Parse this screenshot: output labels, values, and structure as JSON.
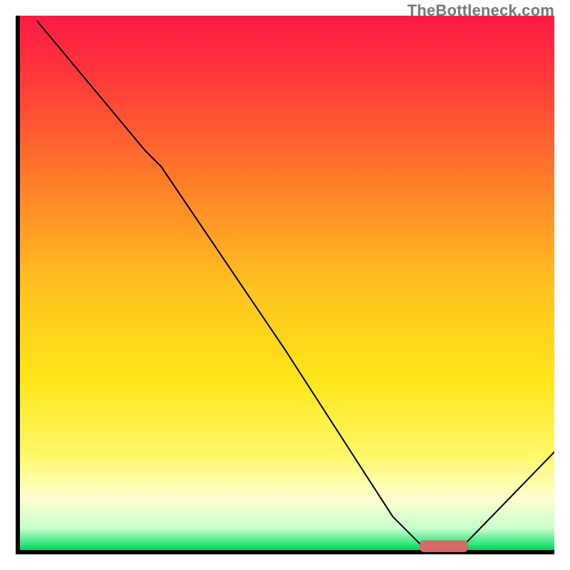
{
  "watermark": "TheBottleneck.com",
  "chart_data": {
    "type": "line",
    "title": "",
    "xlabel": "",
    "ylabel": "",
    "xlim": [
      0,
      100
    ],
    "ylim": [
      0,
      100
    ],
    "series": [
      {
        "name": "curve",
        "color": "#000000",
        "width": 2,
        "x": [
          4,
          14,
          24,
          27,
          50,
          70,
          75,
          82,
          83,
          100
        ],
        "y": [
          99,
          87,
          75,
          72,
          38,
          7,
          2,
          1.5,
          1.5,
          19
        ]
      }
    ],
    "marker": {
      "name": "highlight-bar",
      "color": "#d46a6a",
      "x_start": 75,
      "x_end": 84,
      "y": 1.5,
      "thickness": 2.2
    },
    "background_gradient": {
      "stops": [
        {
          "offset": 0.0,
          "color": "#ff1a44"
        },
        {
          "offset": 0.12,
          "color": "#ff3a3a"
        },
        {
          "offset": 0.3,
          "color": "#ff7a2a"
        },
        {
          "offset": 0.5,
          "color": "#ffc11f"
        },
        {
          "offset": 0.68,
          "color": "#ffe61a"
        },
        {
          "offset": 0.82,
          "color": "#fff86a"
        },
        {
          "offset": 0.9,
          "color": "#fdffd0"
        },
        {
          "offset": 0.955,
          "color": "#c8ffcc"
        },
        {
          "offset": 0.985,
          "color": "#2ee67a"
        },
        {
          "offset": 1.0,
          "color": "#00c060"
        }
      ]
    },
    "axes": {
      "color": "#000000",
      "width": 6
    }
  }
}
